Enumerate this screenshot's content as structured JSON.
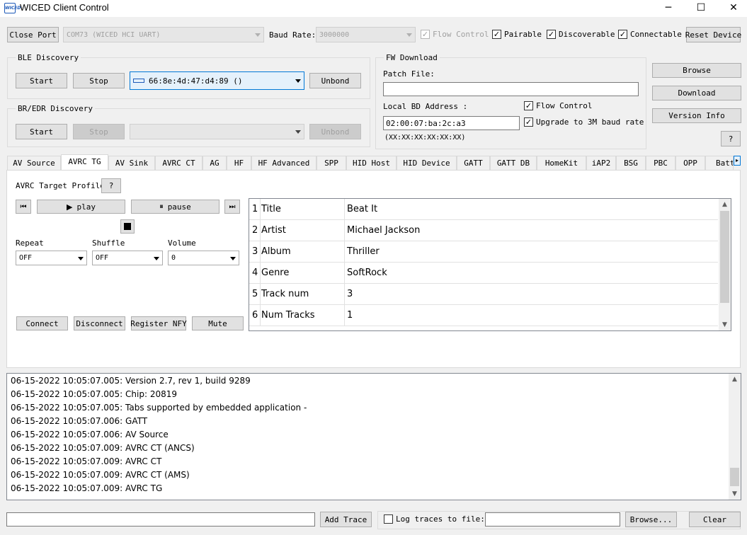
{
  "window": {
    "title": "WICED Client Control",
    "minimize_glyph": "─",
    "maximize_glyph": "☐",
    "close_glyph": "✕",
    "app_icon_text": "WICED"
  },
  "toolbar": {
    "close_port": "Close Port",
    "port_value": "COM73 (WICED HCI UART)",
    "baud_label": "Baud Rate:",
    "baud_value": "3000000",
    "flow_control": "Flow Control",
    "pairable": "Pairable",
    "discoverable": "Discoverable",
    "connectable": "Connectable",
    "reset_device": "Reset Device"
  },
  "ble": {
    "title": "BLE Discovery",
    "start": "Start",
    "stop": "Stop",
    "device": "66:8e:4d:47:d4:89 ()",
    "unbond": "Unbond"
  },
  "bredr": {
    "title": "BR/EDR Discovery",
    "start": "Start",
    "stop": "Stop",
    "device": "",
    "unbond": "Unbond"
  },
  "fw": {
    "title": "FW Download",
    "patch_label": "Patch File:",
    "patch_value": "",
    "bd_label": "Local BD Address :",
    "bd_value": "02:00:07:ba:2c:a3",
    "bd_hint": "(XX:XX:XX:XX:XX:XX)",
    "flow_control": "Flow Control",
    "upgrade": "Upgrade to 3M baud rate"
  },
  "side": {
    "browse": "Browse",
    "download": "Download",
    "version_info": "Version Info",
    "help": "?"
  },
  "tabs": [
    "AV Source",
    "AVRC TG",
    "AV Sink",
    "AVRC CT",
    "AG",
    "HF",
    "HF Advanced",
    "SPP",
    "HID Host",
    "HID Device",
    "GATT",
    "GATT DB",
    "HomeKit",
    "iAP2",
    "BSG",
    "PBC",
    "OPP",
    "Batt"
  ],
  "avrc": {
    "profile_label": "AVRC Target Profile",
    "help": "?",
    "prev_glyph": "⏮",
    "next_glyph": "⏭",
    "play_glyph": "▶",
    "play": "play",
    "pause_glyph": "⏸",
    "pause": "pause",
    "repeat_label": "Repeat",
    "repeat_value": "OFF",
    "shuffle_label": "Shuffle",
    "shuffle_value": "OFF",
    "volume_label": "Volume",
    "volume_value": "0",
    "connect": "Connect",
    "disconnect": "Disconnect",
    "register_nfy": "Register NFY",
    "mute": "Mute",
    "track_rows": [
      {
        "index": "1",
        "field": "Title",
        "value": "Beat It"
      },
      {
        "index": "2",
        "field": "Artist",
        "value": "Michael Jackson"
      },
      {
        "index": "3",
        "field": "Album",
        "value": "Thriller"
      },
      {
        "index": "4",
        "field": "Genre",
        "value": "SoftRock"
      },
      {
        "index": "5",
        "field": "Track num",
        "value": "3"
      },
      {
        "index": "6",
        "field": "Num Tracks",
        "value": "1"
      }
    ]
  },
  "log": [
    "06-15-2022 10:05:07.005: Version 2.7, rev 1, build 9289",
    "06-15-2022 10:05:07.005: Chip: 20819",
    "06-15-2022 10:05:07.005: Tabs supported by embedded application -",
    "06-15-2022 10:05:07.006: GATT",
    "06-15-2022 10:05:07.006: AV Source",
    "06-15-2022 10:05:07.009: AVRC CT (ANCS)",
    "06-15-2022 10:05:07.009: AVRC CT",
    "06-15-2022 10:05:07.009: AVRC CT (AMS)",
    "06-15-2022 10:05:07.009: AVRC TG"
  ],
  "bottom": {
    "trace_value": "",
    "add_trace": "Add Trace",
    "log_to_file": "Log traces to file:",
    "file_value": "",
    "browse": "Browse...",
    "clear": "Clear"
  },
  "colors": {
    "accent": "#0078d7",
    "window_bg": "#f0f0f0",
    "button_bg": "#e1e1e1"
  }
}
